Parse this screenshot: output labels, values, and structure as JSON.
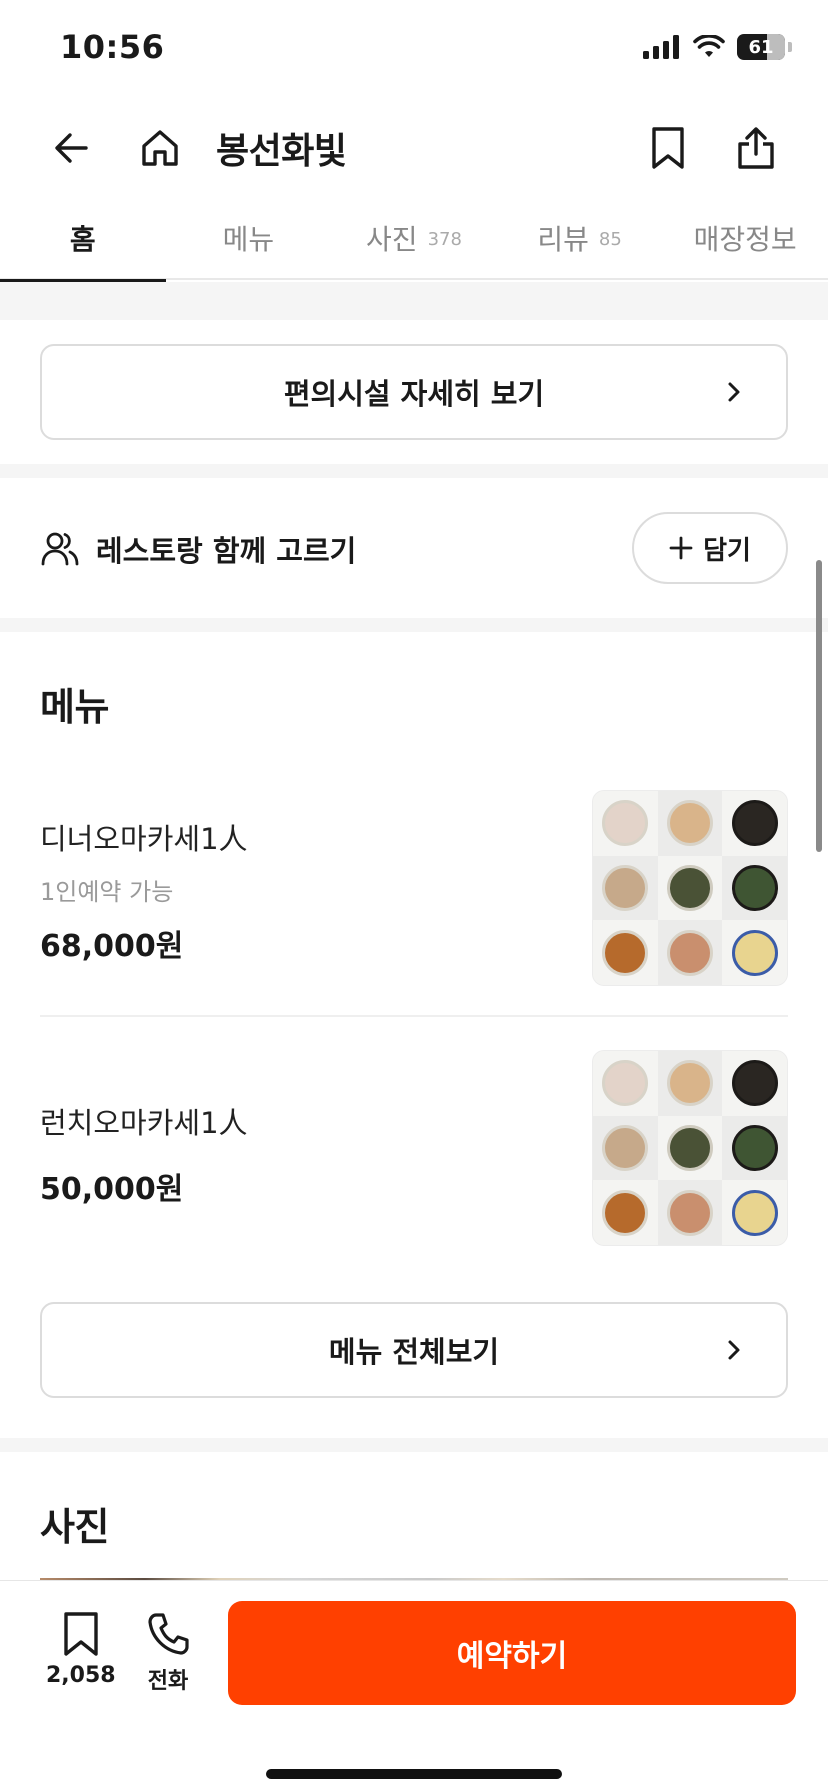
{
  "status_bar": {
    "time": "10:56",
    "battery": "61"
  },
  "header": {
    "title": "봉선화빛"
  },
  "tabs": [
    {
      "label": "홈",
      "count": ""
    },
    {
      "label": "메뉴",
      "count": ""
    },
    {
      "label": "사진",
      "count": "378"
    },
    {
      "label": "리뷰",
      "count": "85"
    },
    {
      "label": "매장정보",
      "count": ""
    }
  ],
  "amenities": {
    "button_label": "편의시설 자세히 보기"
  },
  "together": {
    "label": "레스토랑 함께 고르기",
    "add_label": "담기"
  },
  "menu_section": {
    "title": "메뉴",
    "items": [
      {
        "name": "디너오마카세1人",
        "desc": "1인예약 가능",
        "price": "68,000원"
      },
      {
        "name": "런치오마카세1人",
        "desc": "",
        "price": "50,000원"
      }
    ],
    "view_all_label": "메뉴 전체보기"
  },
  "photo_section": {
    "title": "사진"
  },
  "bottom_bar": {
    "bookmark_count": "2,058",
    "call_label": "전화",
    "reserve_label": "예약하기"
  },
  "colors": {
    "accent": "#ff4000",
    "text": "#1a1a1a",
    "muted": "#9a9a9a",
    "border": "#dcdcdc",
    "band": "#f5f5f5"
  },
  "icons": {
    "back": "arrow-left-icon",
    "home": "home-icon",
    "bookmark": "bookmark-icon",
    "share": "share-icon",
    "chevron": "chevron-right-icon",
    "people": "people-icon",
    "plus": "plus-icon",
    "phone": "phone-icon"
  }
}
